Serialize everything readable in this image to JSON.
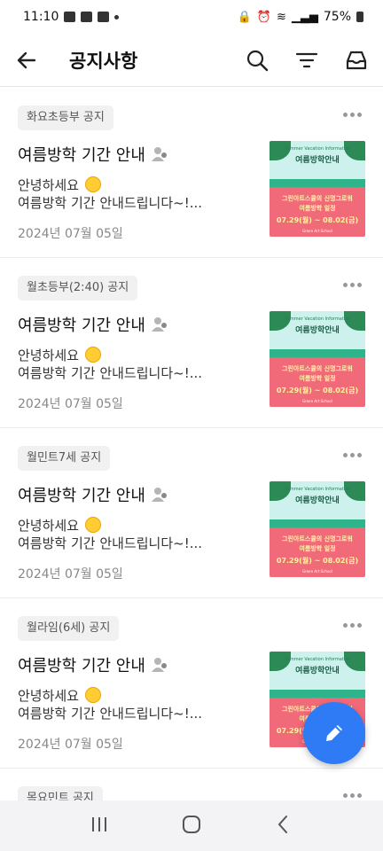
{
  "status_bar": {
    "time": "11:10",
    "battery": "75%"
  },
  "app_bar": {
    "title": "공지사항"
  },
  "notices": [
    {
      "tag": "화요초등부 공지",
      "title": "여름방학 기간 안내",
      "preview_line1": "안녕하세요",
      "preview_line2": "여름방학 기간 안내드립니다~!...",
      "date": "2024년 07월 05일"
    },
    {
      "tag": "월초등부(2:40) 공지",
      "title": "여름방학 기간 안내",
      "preview_line1": "안녕하세요",
      "preview_line2": "여름방학 기간 안내드립니다~!...",
      "date": "2024년 07월 05일"
    },
    {
      "tag": "월민트7세 공지",
      "title": "여름방학 기간 안내",
      "preview_line1": "안녕하세요",
      "preview_line2": "여름방학 기간 안내드립니다~!...",
      "date": "2024년 07월 05일"
    },
    {
      "tag": "월라임(6세) 공지",
      "title": "여름방학 기간 안내",
      "preview_line1": "안녕하세요",
      "preview_line2": "여름방학 기간 안내드립니다~!...",
      "date": "2024년 07월 05일"
    }
  ],
  "thumbnail": {
    "top_text": "Summer Vacation Information",
    "title": "여름방학안내",
    "line1": "그린아트스쿨의 신명그로워",
    "line2": "여름방학 일정",
    "dates": "07.29(월) ~ 08.02(금)",
    "footer": "Green Art School"
  },
  "partial_tag": "목요민트 공지",
  "icons": {
    "back": "arrow-left-icon",
    "search": "search-icon",
    "filter": "filter-icon",
    "inbox": "inbox-icon",
    "edit": "pencil-icon"
  },
  "colors": {
    "fab": "#2f7bf5",
    "tag_bg": "#f1f1f1"
  }
}
